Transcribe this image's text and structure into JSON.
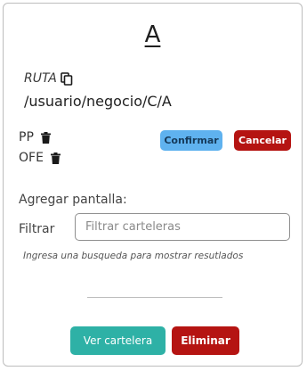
{
  "card": {
    "title": "A",
    "route_label": "RUTA",
    "route_path": "/usuario/negocio/C/A"
  },
  "screens": [
    {
      "name": "PP"
    },
    {
      "name": "OFE"
    }
  ],
  "actions": {
    "confirm_label": "Confirmar",
    "cancel_label": "Cancelar"
  },
  "add_screen": {
    "label": "Agregar pantalla:",
    "filter_label": "Filtrar",
    "filter_placeholder": "Filtrar carteleras",
    "filter_value": "",
    "hint": "Ingresa una busqueda para mostrar resutlados"
  },
  "footer": {
    "view_label": "Ver cartelera",
    "delete_label": "Eliminar"
  },
  "colors": {
    "confirm": "#5fb2ef",
    "danger": "#b51412",
    "teal": "#2eb1a6"
  },
  "icons": [
    "copy-icon",
    "trash-icon"
  ]
}
